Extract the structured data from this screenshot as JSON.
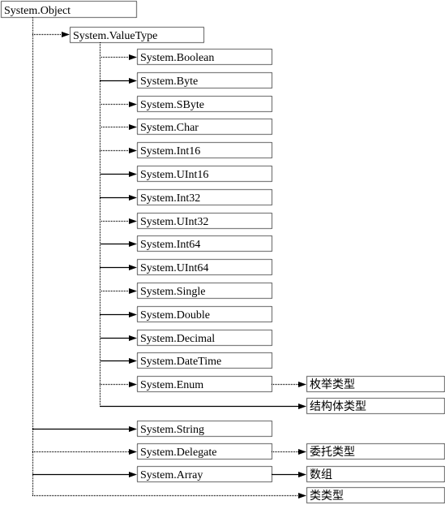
{
  "root": {
    "label": "System.Object"
  },
  "valuetype": {
    "label": "System.ValueType",
    "line": "dotted"
  },
  "value_children": [
    {
      "label": "System.Boolean",
      "line": "dotted"
    },
    {
      "label": "System.Byte",
      "line": "solid"
    },
    {
      "label": "System.SByte",
      "line": "dotted"
    },
    {
      "label": "System.Char",
      "line": "dotted"
    },
    {
      "label": "System.Int16",
      "line": "dotted"
    },
    {
      "label": "System.UInt16",
      "line": "solid"
    },
    {
      "label": "System.Int32",
      "line": "solid"
    },
    {
      "label": "System.UInt32",
      "line": "dotted"
    },
    {
      "label": "System.Int64",
      "line": "solid"
    },
    {
      "label": "System.UInt64",
      "line": "solid"
    },
    {
      "label": "System.Single",
      "line": "dotted"
    },
    {
      "label": "System.Double",
      "line": "solid"
    },
    {
      "label": "System.Decimal",
      "line": "solid"
    },
    {
      "label": "System.DateTime",
      "line": "solid"
    },
    {
      "label": "System.Enum",
      "line": "dotted",
      "child": {
        "label": "枚举类型",
        "line": "dotted"
      }
    }
  ],
  "struct_type": {
    "label": "结构体类型",
    "line": "solid"
  },
  "object_children": [
    {
      "label": "System.String",
      "line": "solid"
    },
    {
      "label": "System.Delegate",
      "line": "dotted",
      "child": {
        "label": "委托类型",
        "line": "dotted"
      }
    },
    {
      "label": "System.Array",
      "line": "solid",
      "child": {
        "label": "数组",
        "line": "solid"
      }
    }
  ],
  "class_type": {
    "label": "类类型",
    "line": "dotted"
  }
}
